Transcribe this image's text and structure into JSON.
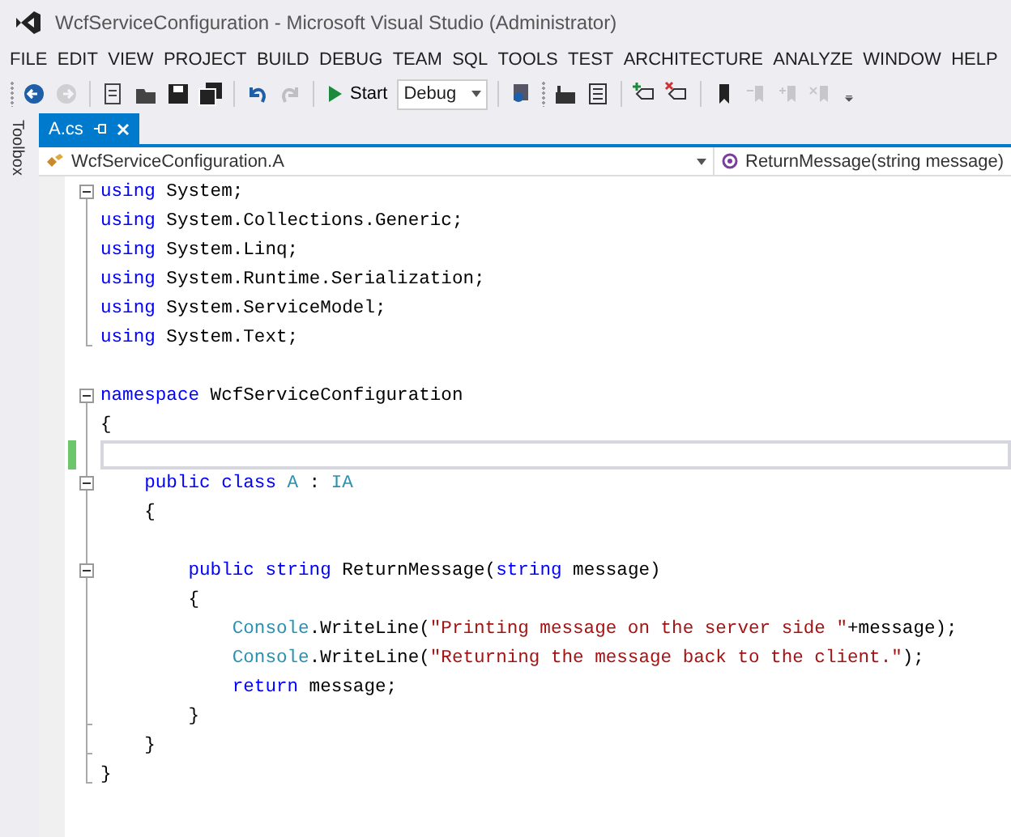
{
  "window": {
    "title": "WcfServiceConfiguration - Microsoft Visual Studio (Administrator)"
  },
  "menu": [
    "FILE",
    "EDIT",
    "VIEW",
    "PROJECT",
    "BUILD",
    "DEBUG",
    "TEAM",
    "SQL",
    "TOOLS",
    "TEST",
    "ARCHITECTURE",
    "ANALYZE",
    "WINDOW",
    "HELP"
  ],
  "toolbar": {
    "start_label": "Start",
    "configuration": "Debug"
  },
  "side_panel": {
    "label": "Toolbox"
  },
  "tabs": [
    {
      "label": "A.cs",
      "selected": true
    }
  ],
  "navigation": {
    "type_selector": "WcfServiceConfiguration.A",
    "member_selector": "ReturnMessage(string message)"
  },
  "code_lines": [
    {
      "collapsible": true,
      "guide": true,
      "guide_end": false,
      "changed": false,
      "current": false,
      "tokens": [
        {
          "kind": "keyword",
          "text": "using"
        },
        {
          "kind": "plain",
          "text": " System;"
        }
      ]
    },
    {
      "collapsible": false,
      "guide": true,
      "guide_end": false,
      "changed": false,
      "current": false,
      "tokens": [
        {
          "kind": "keyword",
          "text": "using"
        },
        {
          "kind": "plain",
          "text": " System.Collections.Generic;"
        }
      ]
    },
    {
      "collapsible": false,
      "guide": true,
      "guide_end": false,
      "changed": false,
      "current": false,
      "tokens": [
        {
          "kind": "keyword",
          "text": "using"
        },
        {
          "kind": "plain",
          "text": " System.Linq;"
        }
      ]
    },
    {
      "collapsible": false,
      "guide": true,
      "guide_end": false,
      "changed": false,
      "current": false,
      "tokens": [
        {
          "kind": "keyword",
          "text": "using"
        },
        {
          "kind": "plain",
          "text": " System.Runtime.Serialization;"
        }
      ]
    },
    {
      "collapsible": false,
      "guide": true,
      "guide_end": false,
      "changed": false,
      "current": false,
      "tokens": [
        {
          "kind": "keyword",
          "text": "using"
        },
        {
          "kind": "plain",
          "text": " System.ServiceModel;"
        }
      ]
    },
    {
      "collapsible": false,
      "guide": true,
      "guide_end": true,
      "changed": false,
      "current": false,
      "tokens": [
        {
          "kind": "keyword",
          "text": "using"
        },
        {
          "kind": "plain",
          "text": " System.Text;"
        }
      ]
    },
    {
      "collapsible": false,
      "guide": false,
      "guide_end": false,
      "changed": false,
      "current": false
    },
    {
      "collapsible": true,
      "guide": true,
      "guide_end": false,
      "changed": false,
      "current": false,
      "tokens": [
        {
          "kind": "keyword",
          "text": "namespace"
        },
        {
          "kind": "plain",
          "text": " WcfServiceConfiguration"
        }
      ]
    },
    {
      "collapsible": false,
      "guide": true,
      "guide_end": false,
      "changed": false,
      "current": false,
      "tokens": [
        {
          "kind": "plain",
          "text": "{"
        }
      ]
    },
    {
      "collapsible": false,
      "guide": true,
      "guide_end": false,
      "changed": true,
      "current": true
    },
    {
      "collapsible": true,
      "guide": true,
      "guide_end": false,
      "changed": false,
      "current": false,
      "tokens": [
        {
          "kind": "keyword",
          "text": "    public class "
        },
        {
          "kind": "type",
          "text": "A"
        },
        {
          "kind": "plain",
          "text": " : "
        },
        {
          "kind": "type",
          "text": "IA"
        }
      ]
    },
    {
      "collapsible": false,
      "guide": true,
      "guide_end": false,
      "changed": false,
      "current": false,
      "tokens": [
        {
          "kind": "plain",
          "text": "    {"
        }
      ]
    },
    {
      "collapsible": false,
      "guide": true,
      "guide_end": false,
      "changed": false,
      "current": false
    },
    {
      "collapsible": true,
      "guide": true,
      "guide_end": false,
      "changed": false,
      "current": false,
      "tokens": [
        {
          "kind": "keyword",
          "text": "        public string"
        },
        {
          "kind": "plain",
          "text": " ReturnMessage("
        },
        {
          "kind": "keyword",
          "text": "string"
        },
        {
          "kind": "plain",
          "text": " message)"
        }
      ]
    },
    {
      "collapsible": false,
      "guide": true,
      "guide_end": false,
      "changed": false,
      "current": false,
      "tokens": [
        {
          "kind": "plain",
          "text": "        {"
        }
      ]
    },
    {
      "collapsible": false,
      "guide": true,
      "guide_end": false,
      "changed": false,
      "current": false,
      "tokens": [
        {
          "kind": "type",
          "text": "            Console"
        },
        {
          "kind": "plain",
          "text": ".WriteLine("
        },
        {
          "kind": "string",
          "text": "\"Printing message on the server side \""
        },
        {
          "kind": "plain",
          "text": "+message);"
        }
      ]
    },
    {
      "collapsible": false,
      "guide": true,
      "guide_end": false,
      "changed": false,
      "current": false,
      "tokens": [
        {
          "kind": "type",
          "text": "            Console"
        },
        {
          "kind": "plain",
          "text": ".WriteLine("
        },
        {
          "kind": "string",
          "text": "\"Returning the message back to the client.\""
        },
        {
          "kind": "plain",
          "text": ");"
        }
      ]
    },
    {
      "collapsible": false,
      "guide": true,
      "guide_end": false,
      "changed": false,
      "current": false,
      "tokens": [
        {
          "kind": "keyword",
          "text": "            return"
        },
        {
          "kind": "plain",
          "text": " message;"
        }
      ]
    },
    {
      "collapsible": false,
      "guide": true,
      "guide_end": true,
      "changed": false,
      "current": false,
      "tokens": [
        {
          "kind": "plain",
          "text": "        }"
        }
      ]
    },
    {
      "collapsible": false,
      "guide": true,
      "guide_end": true,
      "changed": false,
      "current": false,
      "tokens": [
        {
          "kind": "plain",
          "text": "    }"
        }
      ]
    },
    {
      "collapsible": false,
      "guide": true,
      "guide_end": true,
      "changed": false,
      "current": false,
      "tokens": [
        {
          "kind": "plain",
          "text": "}"
        }
      ]
    }
  ]
}
